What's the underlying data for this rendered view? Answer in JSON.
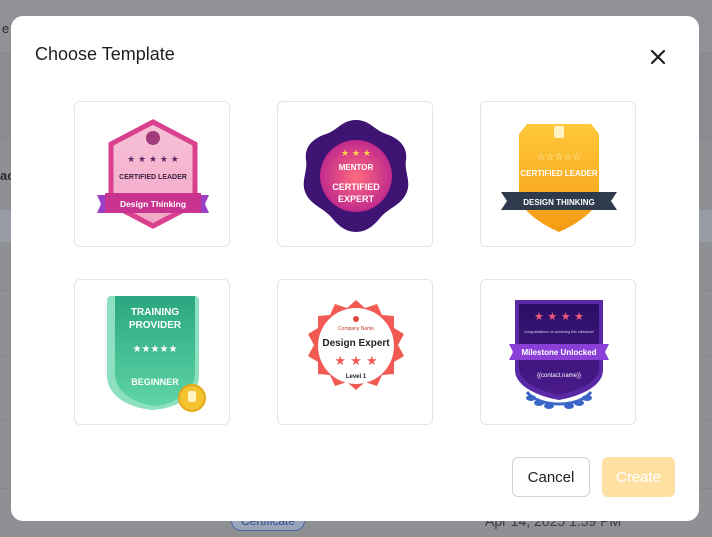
{
  "modal": {
    "title": "Choose Template",
    "close_icon": "close-icon",
    "cancel_label": "Cancel",
    "create_label": "Create"
  },
  "templates": [
    {
      "name": "certified-leader-design-thinking-pink",
      "top_text": "CERTIFIED LEADER",
      "ribbon": "Design Thinking",
      "colors": {
        "main": "#e0559b",
        "ribbon": "#9b3fc9"
      }
    },
    {
      "name": "mentor-certified-expert",
      "top_text": "MENTOR",
      "mid_text": "CERTIFIED",
      "bottom_text": "EXPERT",
      "colors": {
        "main": "#4b1a8c",
        "center": "#f0436a"
      }
    },
    {
      "name": "certified-leader-design-thinking-gold",
      "top_text": "CERTIFIED LEADER",
      "ribbon": "DESIGN THINKING",
      "colors": {
        "main": "#f7a51c",
        "ribbon": "#2f3b4d"
      }
    },
    {
      "name": "training-provider-beginner",
      "top_text": "TRAINING",
      "mid_text": "PROVIDER",
      "bottom_text": "BEGINNER",
      "colors": {
        "main": "#2fb585",
        "medal": "#f2c230"
      }
    },
    {
      "name": "design-expert-level-1",
      "top_text": "Company Name",
      "mid_text": "Design Expert",
      "bottom_text": "Level 1",
      "colors": {
        "main": "#f05a52"
      }
    },
    {
      "name": "milestone-unlocked",
      "top_text": "Congratulations on achieving this milestone!",
      "ribbon": "Milestone Unlocked",
      "bottom_text": "{{contact.name}}",
      "colors": {
        "main": "#3a1478",
        "ribbon": "#8a3fd6",
        "laurel": "#3b66c8"
      }
    }
  ],
  "background": {
    "left_fragment_1": "e",
    "left_fragment_2": "ac",
    "badge_label": "Certificate",
    "date_text": "Apr 14, 2025 1:59 PM"
  }
}
